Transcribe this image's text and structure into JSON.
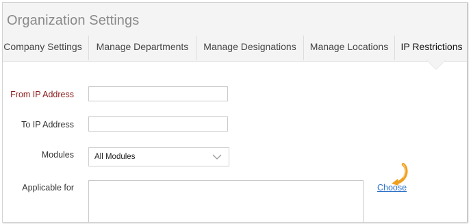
{
  "page_title": "Organization Settings",
  "tabs": [
    {
      "label": "Company Settings",
      "active": false
    },
    {
      "label": "Manage Departments",
      "active": false
    },
    {
      "label": "Manage Designations",
      "active": false
    },
    {
      "label": "Manage Locations",
      "active": false
    },
    {
      "label": "IP Restrictions",
      "active": true
    }
  ],
  "form": {
    "from_ip_label": "From IP Address",
    "from_ip_value": "",
    "to_ip_label": "To IP Address",
    "to_ip_value": "",
    "modules_label": "Modules",
    "modules_selected": "All Modules",
    "applicable_label": "Applicable for",
    "applicable_value": "",
    "choose_label": "Choose"
  },
  "colors": {
    "required_label": "#8b1a1a",
    "link": "#2a6fc9",
    "pointer_accent": "#f0a020"
  },
  "icons": {
    "dropdown": "chevron-down-icon",
    "pointer": "cursor-pointer-icon"
  }
}
